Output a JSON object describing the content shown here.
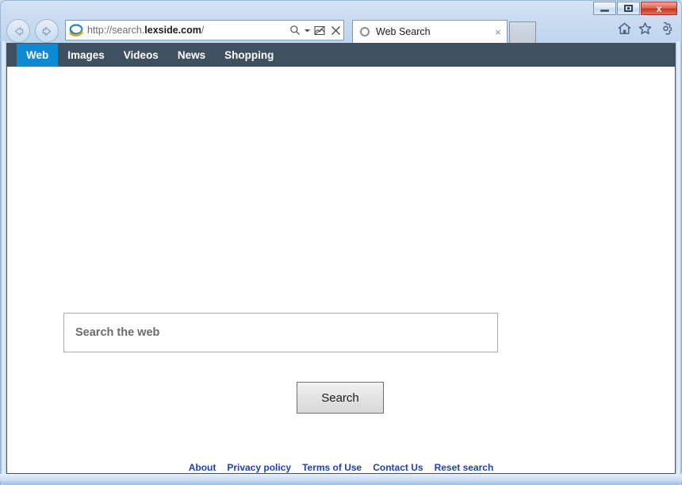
{
  "window": {
    "controls": {
      "minimize_label": "Minimize",
      "maximize_label": "Maximize",
      "close_label": "x"
    }
  },
  "browser": {
    "back_label": "Back",
    "forward_label": "Forward",
    "address": {
      "url_prefix": "http://search.",
      "url_domain": "lexside.com",
      "url_suffix": "/",
      "full_url": "http://search.lexside.com/",
      "search_icon": "magnifier-icon",
      "caret_icon": "caret-down-icon",
      "compat_icon": "compatibility-view-icon",
      "stop_icon": "stop-x-icon"
    },
    "tab": {
      "title": "Web Search",
      "close_label": "×",
      "loading_icon": "loading-spinner-icon"
    },
    "new_tab_label": "New tab",
    "tools": {
      "home_label": "Home",
      "favorites_label": "Favorites",
      "settings_label": "Tools"
    }
  },
  "site": {
    "nav": {
      "items": [
        {
          "label": "Web",
          "active": true
        },
        {
          "label": "Images",
          "active": false
        },
        {
          "label": "Videos",
          "active": false
        },
        {
          "label": "News",
          "active": false
        },
        {
          "label": "Shopping",
          "active": false
        }
      ],
      "background_color": "#3f5160",
      "active_color": "#0d8ad6"
    },
    "search": {
      "placeholder": "Search the web",
      "value": "",
      "button_label": "Search"
    },
    "footer": {
      "links": [
        "About",
        "Privacy policy",
        "Terms of Use",
        "Contact Us",
        "Reset search"
      ],
      "link_color": "#1f3fb8"
    }
  }
}
